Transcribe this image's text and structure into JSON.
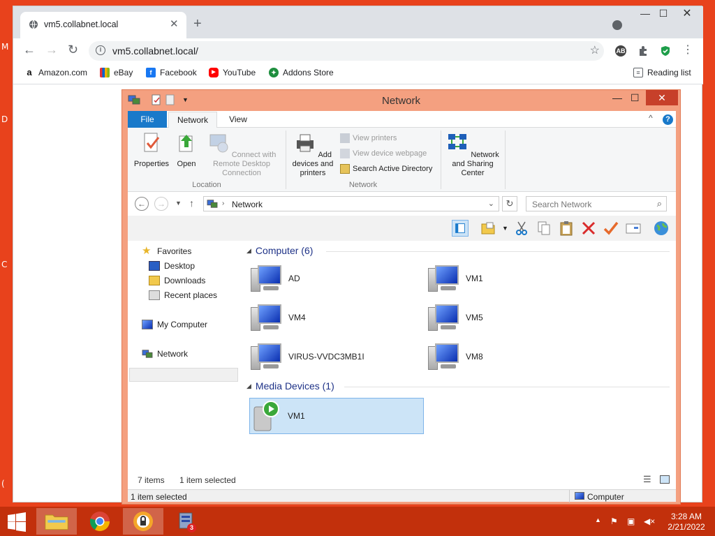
{
  "browser": {
    "tab_title": "vm5.collabnet.local",
    "url": "vm5.collabnet.local/",
    "ext_label": "AB",
    "bookmarks": [
      "Amazon.com",
      "eBay",
      "Facebook",
      "YouTube",
      "Addons Store"
    ],
    "reading_list": "Reading list",
    "colors": {
      "tabstrip": "#dee1e6",
      "accent": "#1a73e8"
    }
  },
  "explorer": {
    "title": "Network",
    "ribbon_tabs": {
      "file": "File",
      "network": "Network",
      "view": "View"
    },
    "ribbon": {
      "properties": "Properties",
      "open": "Open",
      "connect_remote": "Connect with Remote Desktop Connection",
      "location_group": "Location",
      "add_devices": "Add devices and printers",
      "view_printers": "View printers",
      "view_device_webpage": "View device webpage",
      "search_ad": "Search Active Directory",
      "network_group": "Network",
      "network_sharing": "Network and Sharing Center"
    },
    "address": "Network",
    "search_placeholder": "Search Network",
    "nav": {
      "favorites": "Favorites",
      "desktop": "Desktop",
      "downloads": "Downloads",
      "recent_places": "Recent places",
      "my_computer": "My Computer",
      "network": "Network"
    },
    "groups": {
      "computer": "Computer (6)",
      "media": "Media Devices (1)"
    },
    "computers": [
      "AD",
      "VM1",
      "VM4",
      "VM5",
      "VIRUS-VVDC3MB1I",
      "VM8"
    ],
    "media_devices": [
      "VM1"
    ],
    "status": {
      "items": "7 items",
      "selected": "1 item selected"
    },
    "statusbar": {
      "left": "1 item selected",
      "right": "Computer"
    }
  },
  "taskbar": {
    "time": "3:28 AM",
    "date": "2/21/2022",
    "badge": "3",
    "accent": "#c2300c"
  }
}
